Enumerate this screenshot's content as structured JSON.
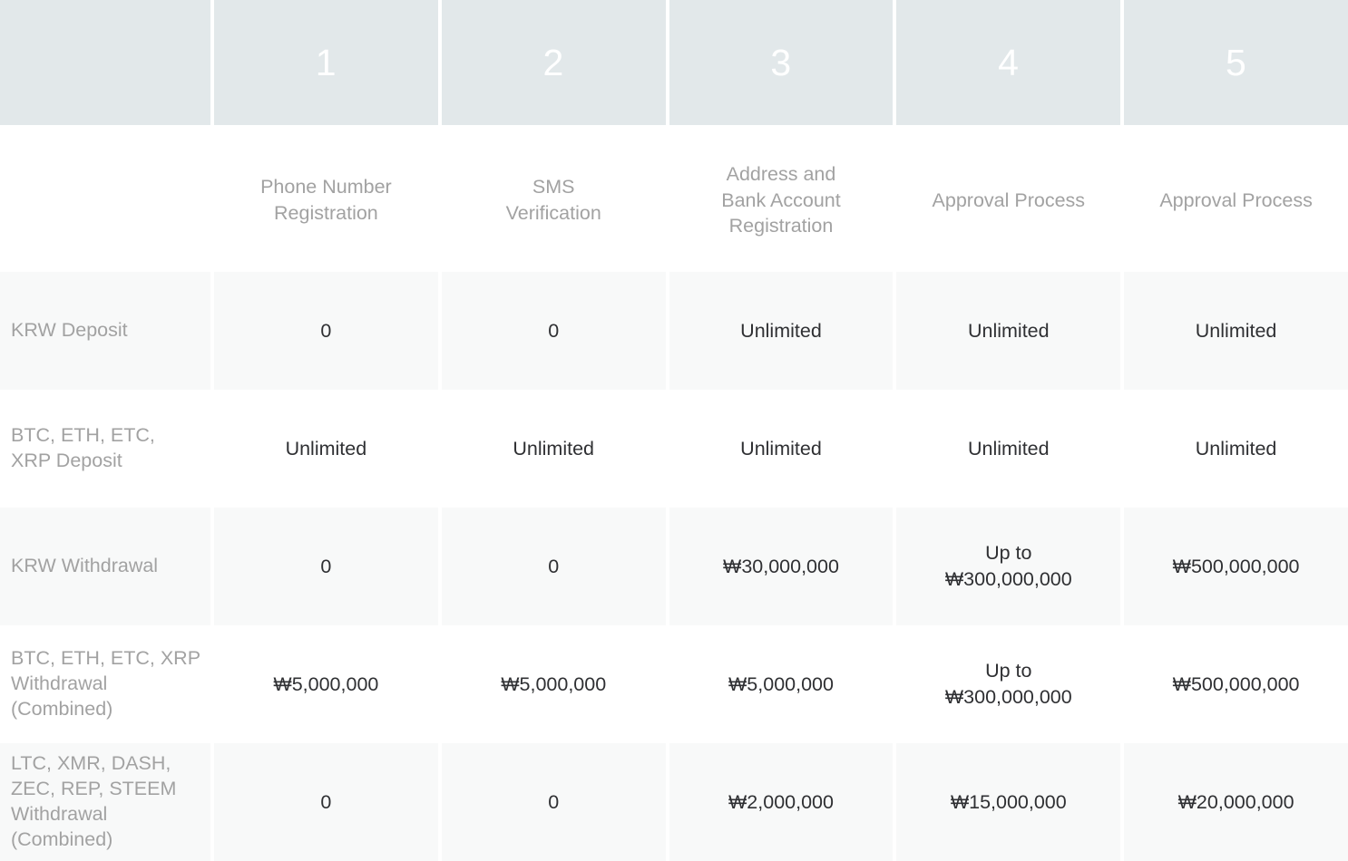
{
  "table": {
    "corner_label": "",
    "step_numbers": [
      "1",
      "2",
      "3",
      "4",
      "5"
    ],
    "step_names": [
      "Phone Number\nRegistration",
      "SMS\nVerification",
      "Address and\nBank Account\nRegistration",
      "Approval Process",
      "Approval Process"
    ],
    "rows": [
      {
        "label": "KRW Deposit",
        "shaded": true,
        "values": [
          "0",
          "0",
          "Unlimited",
          "Unlimited",
          "Unlimited"
        ]
      },
      {
        "label": "BTC, ETH, ETC,\nXRP Deposit",
        "shaded": false,
        "values": [
          "Unlimited",
          "Unlimited",
          "Unlimited",
          "Unlimited",
          "Unlimited"
        ]
      },
      {
        "label": "KRW Withdrawal",
        "shaded": true,
        "values": [
          "0",
          "0",
          "₩30,000,000",
          "Up to\n₩300,000,000",
          "₩500,000,000"
        ]
      },
      {
        "label": "BTC, ETH, ETC, XRP\nWithdrawal\n(Combined)",
        "shaded": false,
        "values": [
          "₩5,000,000",
          "₩5,000,000",
          "₩5,000,000",
          "Up to\n₩300,000,000",
          "₩500,000,000"
        ]
      },
      {
        "label": "LTC, XMR, DASH,\nZEC, REP, STEEM\nWithdrawal\n(Combined)",
        "shaded": true,
        "values": [
          "0",
          "0",
          "₩2,000,000",
          "₩15,000,000",
          "₩20,000,000"
        ]
      }
    ]
  },
  "colors": {
    "header_band": "#e2e8ea",
    "header_number_text": "#ffffff",
    "step_name_text": "#a2a2a2",
    "row_label_text": "#a2a2a2",
    "value_text": "#2f3033",
    "shaded_row": "#f8f9f9",
    "plain_row": "#ffffff",
    "gutter": "#ffffff"
  }
}
